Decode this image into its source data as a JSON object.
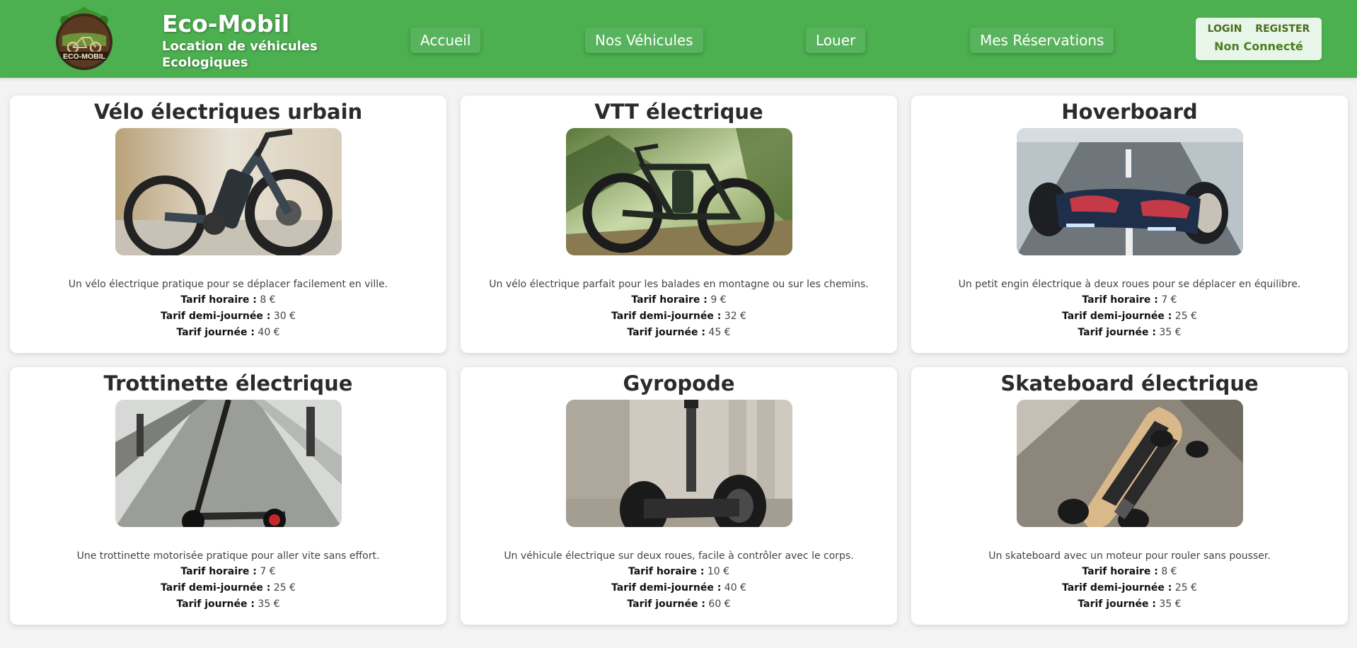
{
  "brand": {
    "logo_text": "ECO-MOBIL",
    "title": "Eco-Mobil",
    "subtitle": "Location de véhicules Ecologiques"
  },
  "nav": {
    "accueil": "Accueil",
    "vehicules": "Nos Véhicules",
    "louer": "Louer",
    "reservations": "Mes Réservations"
  },
  "auth": {
    "login": "LOGIN",
    "register": "REGISTER",
    "status": "Non Connecté"
  },
  "rate_labels": {
    "hourly": "Tarif horaire :",
    "half_day": "Tarif demi-journée :",
    "day": "Tarif journée :"
  },
  "vehicles": [
    {
      "name": "Vélo électriques urbain",
      "description": "Un vélo électrique pratique pour se déplacer facilement en ville.",
      "hourly": "8 €",
      "half_day": "30 €",
      "day": "40 €"
    },
    {
      "name": "VTT électrique",
      "description": "Un vélo électrique parfait pour les balades en montagne ou sur les chemins.",
      "hourly": "9 €",
      "half_day": "32 €",
      "day": "45 €"
    },
    {
      "name": "Hoverboard",
      "description": "Un petit engin électrique à deux roues pour se déplacer en équilibre.",
      "hourly": "7 €",
      "half_day": "25 €",
      "day": "35 €"
    },
    {
      "name": "Trottinette électrique",
      "description": "Une trottinette motorisée pratique pour aller vite sans effort.",
      "hourly": "7 €",
      "half_day": "25 €",
      "day": "35 €"
    },
    {
      "name": "Gyropode",
      "description": "Un véhicule électrique sur deux roues, facile à contrôler avec le corps.",
      "hourly": "10 €",
      "half_day": "40 €",
      "day": "60 €"
    },
    {
      "name": "Skateboard électrique",
      "description": "Un skateboard avec un moteur pour rouler sans pousser.",
      "hourly": "8 €",
      "half_day": "25 €",
      "day": "35 €"
    }
  ]
}
